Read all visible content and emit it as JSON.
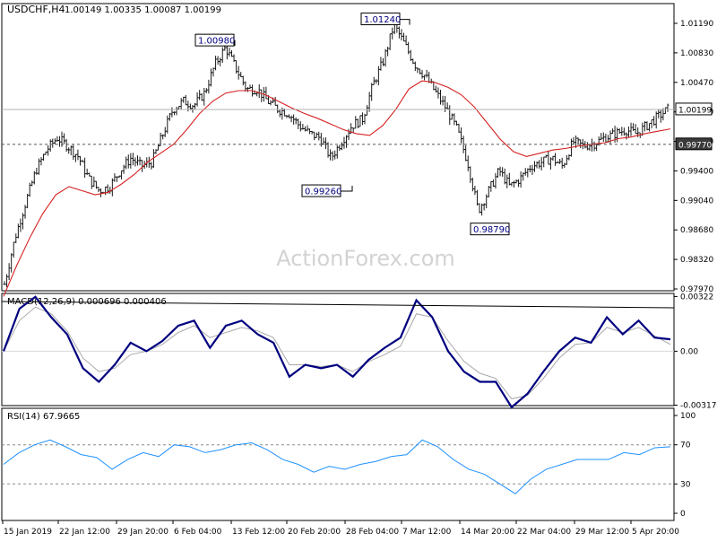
{
  "header": {
    "symbol": "USDCHF,H4",
    "ohlc": "1.00149 1.00335 1.00087 1.00199"
  },
  "watermark": "ActionForex.com",
  "colors": {
    "candle": "#1a1a1a",
    "moving_average": "#d62020",
    "macd_line": "#000080",
    "macd_signal": "#a9a9a9",
    "rsi": "#1e90ff",
    "guide": "#555555"
  },
  "chart_data": [
    {
      "type": "line",
      "panel": "price",
      "ylim": [
        0.9797,
        1.015
      ],
      "y_ticks": [
        "1.01190",
        "1.00830",
        "1.00470",
        "1.00110",
        "0.99740",
        "0.99400",
        "0.99040",
        "0.98680",
        "0.98320",
        "0.97970"
      ],
      "x_ticks": [
        "15 Jan 2019",
        "22 Jan 12:00",
        "29 Jan 20:00",
        "6 Feb 04:00",
        "13 Feb 12:00",
        "20 Feb 20:00",
        "28 Feb 04:00",
        "7 Mar 12:00",
        "14 Mar 20:00",
        "22 Mar 04:00",
        "29 Mar 12:00",
        "5 Apr 20:00"
      ],
      "series": [
        {
          "values": [
            0.9805,
            0.9862,
            0.9905,
            0.9945,
            0.997,
            0.9985,
            0.9975,
            0.9962,
            0.9935,
            0.992,
            0.9925,
            0.9945,
            0.996,
            0.995,
            0.9955,
            0.9988,
            1.002,
            1.003,
            1.0025,
            1.004,
            1.0075,
            1.0096,
            1.007,
            1.0045,
            1.0045,
            1.003,
            1.002,
            1.0015,
            1.0,
            0.999,
            0.9985,
            0.996,
            0.998,
            1.0,
            1.0008,
            1.005,
            1.008,
            1.0124,
            1.01,
            1.0075,
            1.006,
            1.004,
            1.002,
            0.9995,
            0.9955,
            0.9895,
            0.992,
            0.9945,
            0.9925,
            0.9935,
            0.995,
            0.9955,
            0.996,
            0.995,
            0.998,
            0.9975,
            0.9978,
            0.9985,
            0.999,
            0.9995,
            0.999,
            1.0,
            1.001,
            1.002
          ]
        },
        {
          "values": [
            0.979,
            0.9828,
            0.9862,
            0.9892,
            0.9915,
            0.9925,
            0.992,
            0.9915,
            0.9918,
            0.9928,
            0.994,
            0.9955,
            0.9966,
            0.9977,
            0.9995,
            1.0015,
            1.003,
            1.004,
            1.0043,
            1.0043,
            1.0038,
            1.003,
            1.0022,
            1.0015,
            1.0009,
            1.0002,
            0.9995,
            0.999,
            0.9988,
            1.0,
            1.002,
            1.0045,
            1.0055,
            1.0053,
            1.0047,
            1.0038,
            1.0023,
            1.0003,
            0.9983,
            0.9968,
            0.9962,
            0.9966,
            0.997,
            0.9972,
            0.9975,
            0.9977,
            0.9979,
            0.9984,
            0.9986,
            0.999,
            0.9993,
            0.9996
          ]
        }
      ],
      "annotations": [
        {
          "label": "1.00980",
          "value": 1.0098
        },
        {
          "label": "1.01240",
          "value": 1.0124
        },
        {
          "label": "0.99260",
          "value": 0.9926
        },
        {
          "label": "0.98790",
          "value": 0.9879
        }
      ],
      "current_price": {
        "label": "1.00199",
        "value": 1.00199
      },
      "support": {
        "label": "0.99770",
        "value": 0.9977
      }
    },
    {
      "type": "line",
      "panel": "macd",
      "title": "MACD(12,26,9) 0.000696 0.000406",
      "ylim": [
        -0.0032,
        0.0034
      ],
      "y_ticks": [
        "0.00322",
        "0.00",
        "-0.003174"
      ],
      "series": [
        {
          "values": [
            0.0,
            0.0025,
            0.0032,
            0.002,
            0.001,
            -0.001,
            -0.0018,
            -0.0008,
            0.0005,
            0.0,
            0.0006,
            0.0015,
            0.0018,
            0.0002,
            0.0015,
            0.0018,
            0.001,
            0.0005,
            -0.0015,
            -0.0008,
            -0.001,
            -0.0008,
            -0.0015,
            -0.0005,
            0.0002,
            0.0008,
            0.003,
            0.002,
            0.0,
            -0.0012,
            -0.0018,
            -0.0018,
            -0.0033,
            -0.0025,
            -0.0012,
            0.0,
            0.0008,
            0.0005,
            0.002,
            0.001,
            0.0018,
            0.0008,
            0.0007
          ]
        },
        {
          "values": [
            0.0,
            0.0018,
            0.0026,
            0.0022,
            0.0012,
            -0.0004,
            -0.0012,
            -0.001,
            -0.0002,
            0.0,
            0.0004,
            0.0011,
            0.0015,
            0.0008,
            0.0011,
            0.0014,
            0.0012,
            0.0008,
            -0.0008,
            -0.0008,
            -0.0009,
            -0.0008,
            -0.0012,
            -0.0006,
            -0.0002,
            0.0003,
            0.0022,
            0.002,
            0.0006,
            -0.0006,
            -0.0013,
            -0.0016,
            -0.0028,
            -0.0026,
            -0.0016,
            -0.0004,
            0.0004,
            0.0005,
            0.0014,
            0.0011,
            0.0014,
            0.0009,
            0.0004
          ]
        }
      ]
    },
    {
      "type": "line",
      "panel": "rsi",
      "title": "RSI(14) 67.9665",
      "ylim": [
        0,
        100
      ],
      "y_ticks": [
        "100",
        "70",
        "30",
        "0"
      ],
      "series": [
        {
          "values": [
            50,
            62,
            70,
            75,
            68,
            60,
            57,
            45,
            55,
            62,
            58,
            70,
            68,
            62,
            65,
            70,
            72,
            65,
            55,
            50,
            42,
            48,
            45,
            50,
            53,
            58,
            60,
            75,
            68,
            55,
            45,
            40,
            30,
            20,
            35,
            45,
            50,
            55,
            55,
            55,
            62,
            60,
            67,
            68
          ]
        }
      ]
    }
  ]
}
